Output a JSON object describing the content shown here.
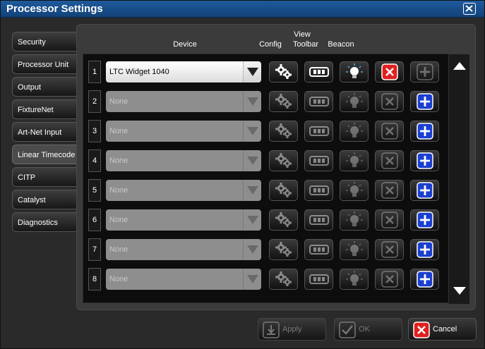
{
  "window": {
    "title": "Processor Settings"
  },
  "tabs": [
    {
      "label": "Security",
      "active": false
    },
    {
      "label": "Processor Unit",
      "active": false
    },
    {
      "label": "Output",
      "active": false
    },
    {
      "label": "FixtureNet",
      "active": false
    },
    {
      "label": "Art-Net Input",
      "active": false
    },
    {
      "label": "Linear Timecode",
      "active": true
    },
    {
      "label": "CITP",
      "active": false
    },
    {
      "label": "Catalyst",
      "active": false
    },
    {
      "label": "Diagnostics",
      "active": false
    }
  ],
  "columns": {
    "device": "Device",
    "config": "Config",
    "view_toolbar_line1": "View",
    "view_toolbar_line2": "Toolbar",
    "beacon": "Beacon"
  },
  "rows": [
    {
      "num": "1",
      "device": "LTC Widget 1040",
      "active": true
    },
    {
      "num": "2",
      "device": "None",
      "active": false
    },
    {
      "num": "3",
      "device": "None",
      "active": false
    },
    {
      "num": "4",
      "device": "None",
      "active": false
    },
    {
      "num": "5",
      "device": "None",
      "active": false
    },
    {
      "num": "6",
      "device": "None",
      "active": false
    },
    {
      "num": "7",
      "device": "None",
      "active": false
    },
    {
      "num": "8",
      "device": "None",
      "active": false
    }
  ],
  "footer": {
    "apply": "Apply",
    "ok": "OK",
    "cancel": "Cancel"
  },
  "colors": {
    "titlebar": "#1a4f8a",
    "remove_red": "#e02020",
    "add_blue": "#1a3fd0"
  }
}
